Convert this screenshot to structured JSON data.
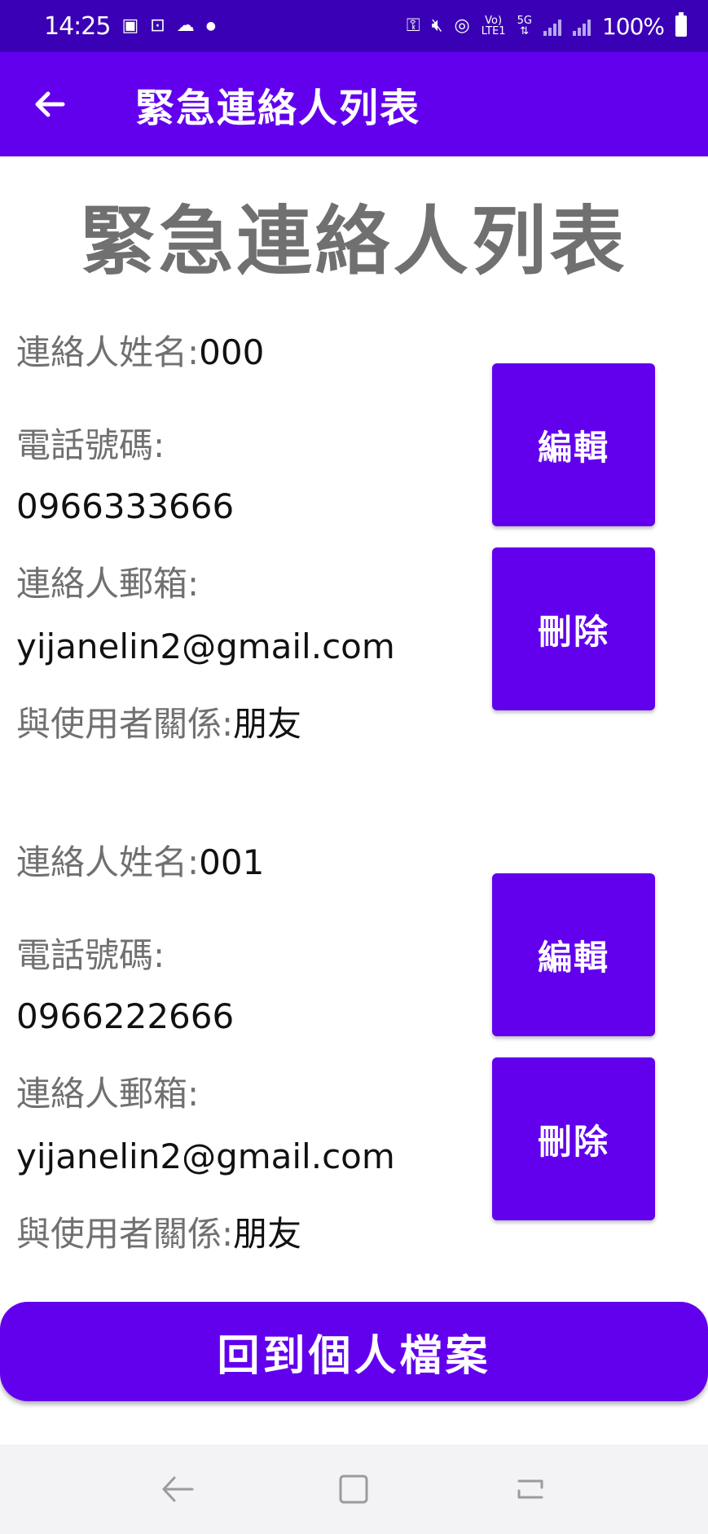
{
  "status_bar": {
    "time": "14:25",
    "network_top": "Vo)",
    "network_bottom": "LTE1",
    "network2_top": "5G",
    "battery": "100%"
  },
  "app_bar": {
    "title": "緊急連絡人列表"
  },
  "page": {
    "heading": "緊急連絡人列表"
  },
  "labels": {
    "name": "連絡人姓名:",
    "phone": "電話號碼:",
    "email": "連絡人郵箱:",
    "relation": "與使用者關係:",
    "edit": "編輯",
    "delete": "刪除"
  },
  "contacts": [
    {
      "name": "000",
      "phone": "0966333666",
      "email": "yijanelin2@gmail.com",
      "relation": "朋友"
    },
    {
      "name": "001",
      "phone": "0966222666",
      "email": "yijanelin2@gmail.com",
      "relation": "朋友"
    }
  ],
  "footer": {
    "profile_button": "回到個人檔案"
  },
  "colors": {
    "primary": "#6200ee",
    "status_bar": "#3a00b5",
    "label_gray": "#707070"
  },
  "icons": [
    "back-arrow-icon",
    "nav-back-icon",
    "nav-home-icon",
    "nav-recents-icon"
  ]
}
